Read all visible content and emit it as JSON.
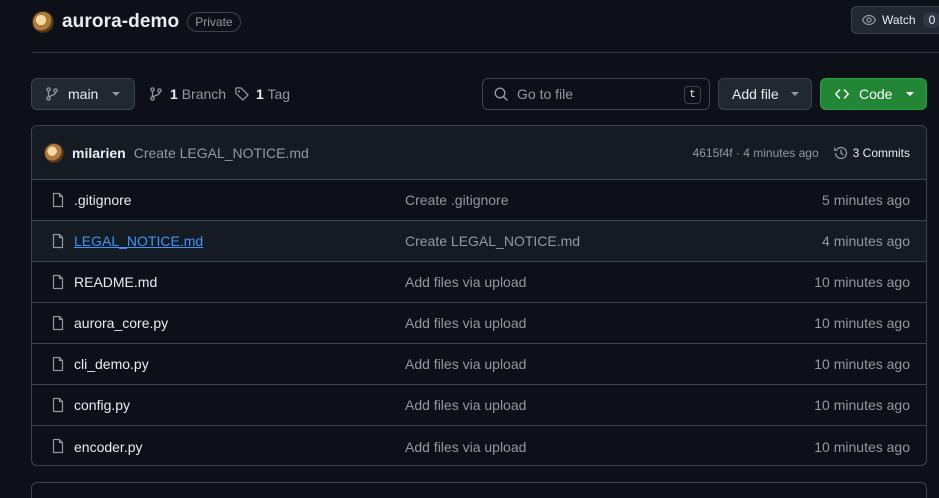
{
  "repo": {
    "name": "aurora-demo",
    "visibility": "Private"
  },
  "watch": {
    "label": "Watch",
    "count": "0"
  },
  "toolbar": {
    "branch": "main",
    "branch_count": "1",
    "branch_label": "Branch",
    "tag_count": "1",
    "tag_label": "Tag",
    "search_placeholder": "Go to file",
    "search_shortcut": "t",
    "add_file_label": "Add file",
    "code_label": "Code"
  },
  "commit": {
    "author": "milarien",
    "message": "Create LEGAL_NOTICE.md",
    "hash_time": "4615f4f · 4 minutes ago",
    "commits_label": "3 Commits"
  },
  "files": [
    {
      "name": ".gitignore",
      "message": "Create .gitignore",
      "time": "5 minutes ago"
    },
    {
      "name": "LEGAL_NOTICE.md",
      "message": "Create LEGAL_NOTICE.md",
      "time": "4 minutes ago"
    },
    {
      "name": "README.md",
      "message": "Add files via upload",
      "time": "10 minutes ago"
    },
    {
      "name": "aurora_core.py",
      "message": "Add files via upload",
      "time": "10 minutes ago"
    },
    {
      "name": "cli_demo.py",
      "message": "Add files via upload",
      "time": "10 minutes ago"
    },
    {
      "name": "config.py",
      "message": "Add files via upload",
      "time": "10 minutes ago"
    },
    {
      "name": "encoder.py",
      "message": "Add files via upload",
      "time": "10 minutes ago"
    }
  ],
  "colors": {
    "background": "#0d1117",
    "code_button": "#238636",
    "link": "#4493f8",
    "muted": "#9198a1"
  }
}
